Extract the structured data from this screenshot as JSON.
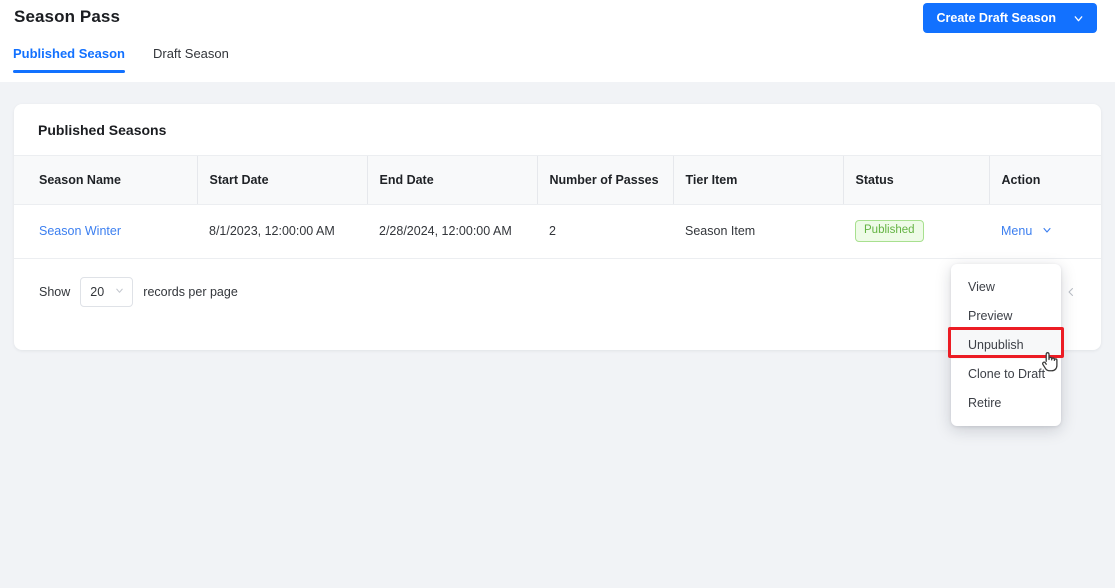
{
  "header": {
    "title": "Season Pass",
    "create_button": {
      "label": "Create Draft Season",
      "icon": "chevron-down-icon",
      "color": "#1271ff"
    }
  },
  "tabs": [
    {
      "label": "Published Season",
      "active": true
    },
    {
      "label": "Draft Season",
      "active": false
    }
  ],
  "card": {
    "title": "Published Seasons",
    "table": {
      "columns": [
        "Season Name",
        "Start Date",
        "End Date",
        "Number of Passes",
        "Tier Item",
        "Status",
        "Action"
      ],
      "rows": [
        {
          "season_name": "Season Winter",
          "start_date": "8/1/2023, 12:00:00 AM",
          "end_date": "2/28/2024, 12:00:00 AM",
          "number_of_passes": "2",
          "tier_item": "Season Item",
          "status": "Published",
          "action": "Menu"
        }
      ]
    },
    "footer": {
      "show_label": "Show",
      "records_per_page_value": "20",
      "records_label": "records per page",
      "pager_prev": "‹"
    }
  },
  "dropdown": {
    "items": [
      {
        "label": "View",
        "hovered": false
      },
      {
        "label": "Preview",
        "hovered": false
      },
      {
        "label": "Unpublish",
        "hovered": true
      },
      {
        "label": "Clone to Draft",
        "hovered": false
      },
      {
        "label": "Retire",
        "hovered": false
      }
    ],
    "highlight_color": "#ec1c24",
    "highlighted_item": "Unpublish"
  },
  "colors": {
    "accent": "#1271ff",
    "link": "#3c7ff0",
    "status_badge_text": "#63b342",
    "status_badge_bg": "#eefbe7",
    "status_badge_border": "#a8e08f",
    "page_background": "#f1f3f6"
  }
}
